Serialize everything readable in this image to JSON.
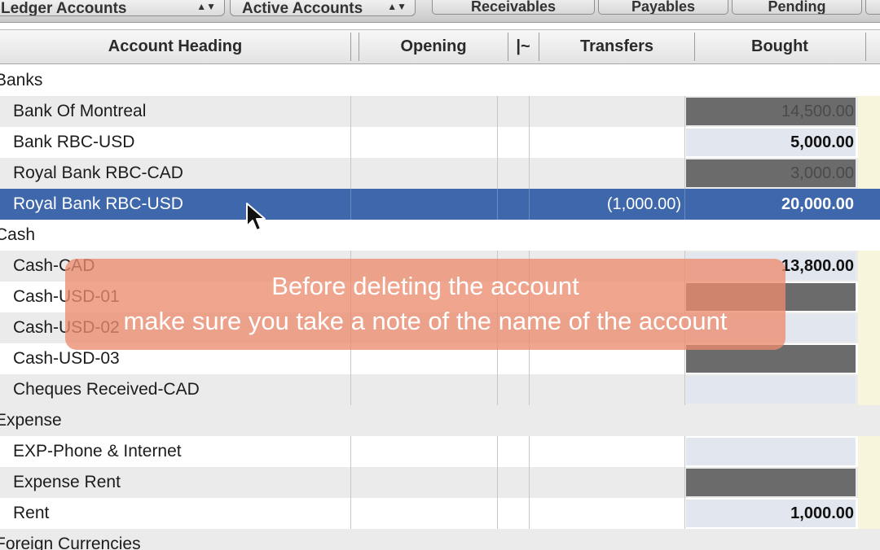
{
  "toolbar": {
    "ledger_popup": "Ledger Accounts",
    "filter_popup": "Active Accounts",
    "tabs": [
      "Receivables",
      "Payables",
      "Pending"
    ]
  },
  "columns": {
    "account_heading": "Account Heading",
    "opening": "Opening",
    "marker": "|~",
    "transfers": "Transfers",
    "bought": "Bought"
  },
  "rows": [
    {
      "label": "Banks",
      "group": true
    },
    {
      "label": "Bank Of Montreal",
      "bought": "14,500.00"
    },
    {
      "label": "Bank RBC-USD",
      "bought": "5,000.00"
    },
    {
      "label": "Royal Bank RBC-CAD",
      "bought": "3,000.00"
    },
    {
      "label": "Royal Bank RBC-USD",
      "transfers": "(1,000.00)",
      "bought": "20,000.00",
      "selected": true
    },
    {
      "label": "Cash",
      "group": true
    },
    {
      "label": "Cash-CAD",
      "bought": "13,800.00"
    },
    {
      "label": "Cash-USD-01",
      "bought": ""
    },
    {
      "label": "Cash-USD-02",
      "bought": ""
    },
    {
      "label": "Cash-USD-03",
      "bought": ""
    },
    {
      "label": "Cheques Received-CAD",
      "bought": ""
    },
    {
      "label": "Expense",
      "group": true
    },
    {
      "label": "EXP-Phone & Internet",
      "bought": ""
    },
    {
      "label": "Expense Rent",
      "bought": ""
    },
    {
      "label": "Rent",
      "bought": "1,000.00"
    },
    {
      "label": "Foreign Currencies",
      "group": true
    }
  ],
  "overlay": {
    "line1": "Before deleting the account",
    "line2": "make sure you take a note of the name of the account"
  },
  "colors": {
    "selection": "#3f68ac",
    "overlay": "#ec8c70",
    "bought_cell": "#e2e6ee",
    "bought_cell_dark": "#6b6b6b"
  }
}
